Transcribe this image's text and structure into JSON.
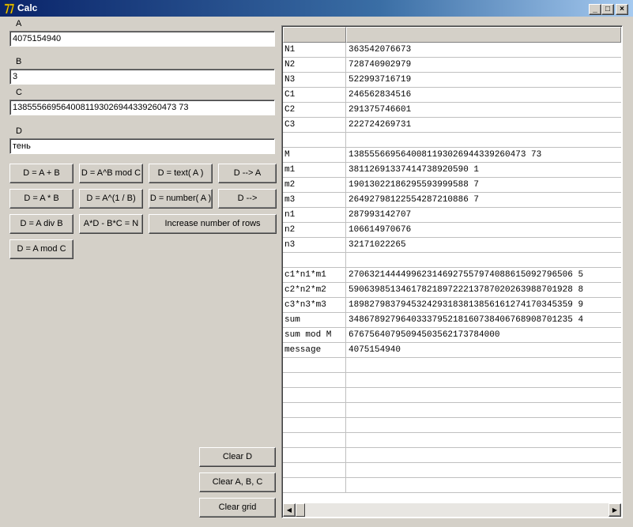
{
  "window": {
    "title": "Calc",
    "controls": {
      "minimize": "_",
      "maximize": "□",
      "close": "×"
    }
  },
  "fields": {
    "a": {
      "label": "A",
      "value": "4075154940"
    },
    "b": {
      "label": "B",
      "value": "3"
    },
    "c": {
      "label": "C",
      "value": "1385556695640081193026944339260473 73"
    },
    "d": {
      "label": "D",
      "value": "тень"
    }
  },
  "buttons": {
    "add": "D = A + B",
    "powmod": "D = A^B mod C",
    "text": "D = text( A )",
    "copy_d_to_a": "D --> A",
    "mul": "D = A * B",
    "root": "D = A^(1 / B)",
    "number": "D = number( A )",
    "copy_d": "D -->",
    "div": "D = A div B",
    "eq": "A*D - B*C = N",
    "increase_rows": "Increase number of rows",
    "mod": "D = A mod C",
    "clear_d": "Clear D",
    "clear_abc": "Clear A, B, C",
    "clear_grid": "Clear grid"
  },
  "grid": {
    "rows": [
      {
        "name": "N1",
        "value": "363542076673"
      },
      {
        "name": "N2",
        "value": "728740902979"
      },
      {
        "name": "N3",
        "value": "522993716719"
      },
      {
        "name": "C1",
        "value": "246562834516"
      },
      {
        "name": "C2",
        "value": "291375746601"
      },
      {
        "name": "C3",
        "value": "222724269731"
      },
      {
        "name": "",
        "value": ""
      },
      {
        "name": "M",
        "value": "1385556695640081193026944339260473 73"
      },
      {
        "name": "m1",
        "value": "38112691337414738920590 1"
      },
      {
        "name": "m2",
        "value": "19013022186295593999588 7"
      },
      {
        "name": "m3",
        "value": "26492798122554287210886 7"
      },
      {
        "name": "n1",
        "value": "287993142707"
      },
      {
        "name": "n2",
        "value": "106614970676"
      },
      {
        "name": "n3",
        "value": "32171022265"
      },
      {
        "name": "",
        "value": ""
      },
      {
        "name": "c1*n1*m1",
        "value": "2706321444499623146927557974088615092796506 5"
      },
      {
        "name": "c2*n2*m2",
        "value": "5906398513461782189722213787020263988701928 8"
      },
      {
        "name": "c3*n3*m3",
        "value": "1898279837945324293183813856161274170345359 9"
      },
      {
        "name": "sum",
        "value": "3486789279640333795218160738406768908701235 4"
      },
      {
        "name": "sum mod M",
        "value": "67675640795094503562173784000"
      },
      {
        "name": "message",
        "value": "4075154940"
      },
      {
        "name": "",
        "value": ""
      },
      {
        "name": "",
        "value": ""
      },
      {
        "name": "",
        "value": ""
      },
      {
        "name": "",
        "value": ""
      },
      {
        "name": "",
        "value": ""
      },
      {
        "name": "",
        "value": ""
      },
      {
        "name": "",
        "value": ""
      },
      {
        "name": "",
        "value": ""
      },
      {
        "name": "",
        "value": ""
      }
    ]
  }
}
